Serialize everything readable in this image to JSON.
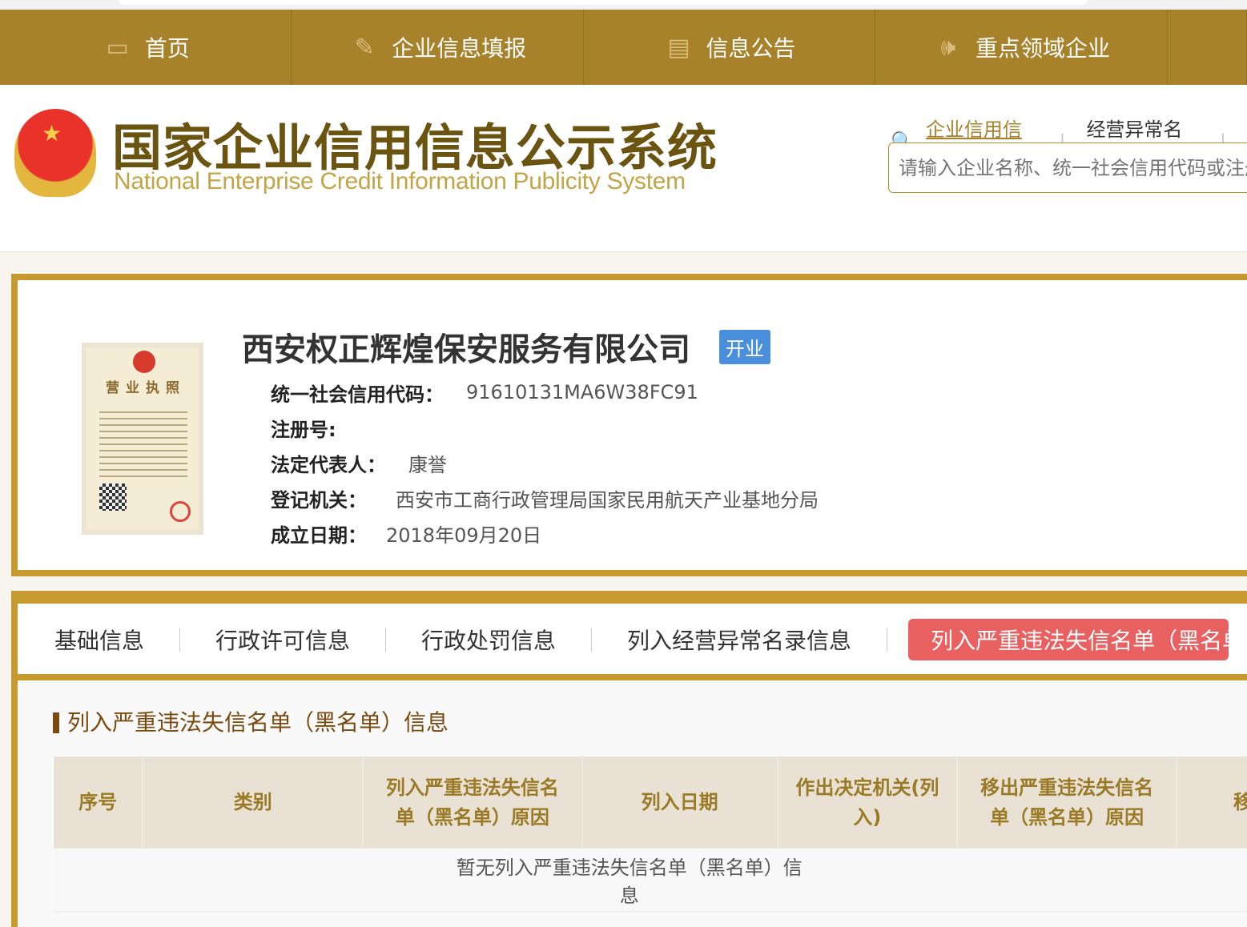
{
  "nav": [
    {
      "icon": "monitor-icon",
      "label": "首页"
    },
    {
      "icon": "pen-icon",
      "label": "企业信息填报"
    },
    {
      "icon": "document-icon",
      "label": "信息公告"
    },
    {
      "icon": "speaker-icon",
      "label": "重点领域企业"
    }
  ],
  "header": {
    "title_cn": "国家企业信用信息公示系统",
    "title_en": "National Enterprise Credit Information Publicity System",
    "search_links": [
      "企业信用信息",
      "经营异常名录"
    ],
    "search_placeholder": "请输入企业名称、统一社会信用代码或注册号"
  },
  "company": {
    "name": "西安权正辉煌保安服务有限公司",
    "status": "开业",
    "license_title": "营业执照",
    "fields": [
      {
        "label": "统一社会信用代码：",
        "value": "91610131MA6W38FC91"
      },
      {
        "label": "注册号:",
        "value": ""
      },
      {
        "label": "法定代表人：",
        "value": "康誉"
      },
      {
        "label": "登记机关：",
        "value": "西安市工商行政管理局国家民用航天产业基地分局"
      },
      {
        "label": "成立日期：",
        "value": "2018年09月20日"
      }
    ]
  },
  "tabs": [
    "基础信息",
    "行政许可信息",
    "行政处罚信息",
    "列入经营异常名录信息",
    "列入严重违法失信名单（黑名单）信息"
  ],
  "section": {
    "title": "列入严重违法失信名单（黑名单）信息",
    "columns": [
      "序号",
      "类别",
      "列入严重违法失信名单（黑名单）原因",
      "列入日期",
      "作出决定机关(列入)",
      "移出严重违法失信名单（黑名单）原因",
      "移"
    ],
    "empty": "暂无列入严重违法失信名单（黑名单）信息"
  },
  "colors": {
    "nav": "#a8822a",
    "border": "#c69a2e",
    "active_tab": "#e96060",
    "badge": "#4a8fdb"
  }
}
